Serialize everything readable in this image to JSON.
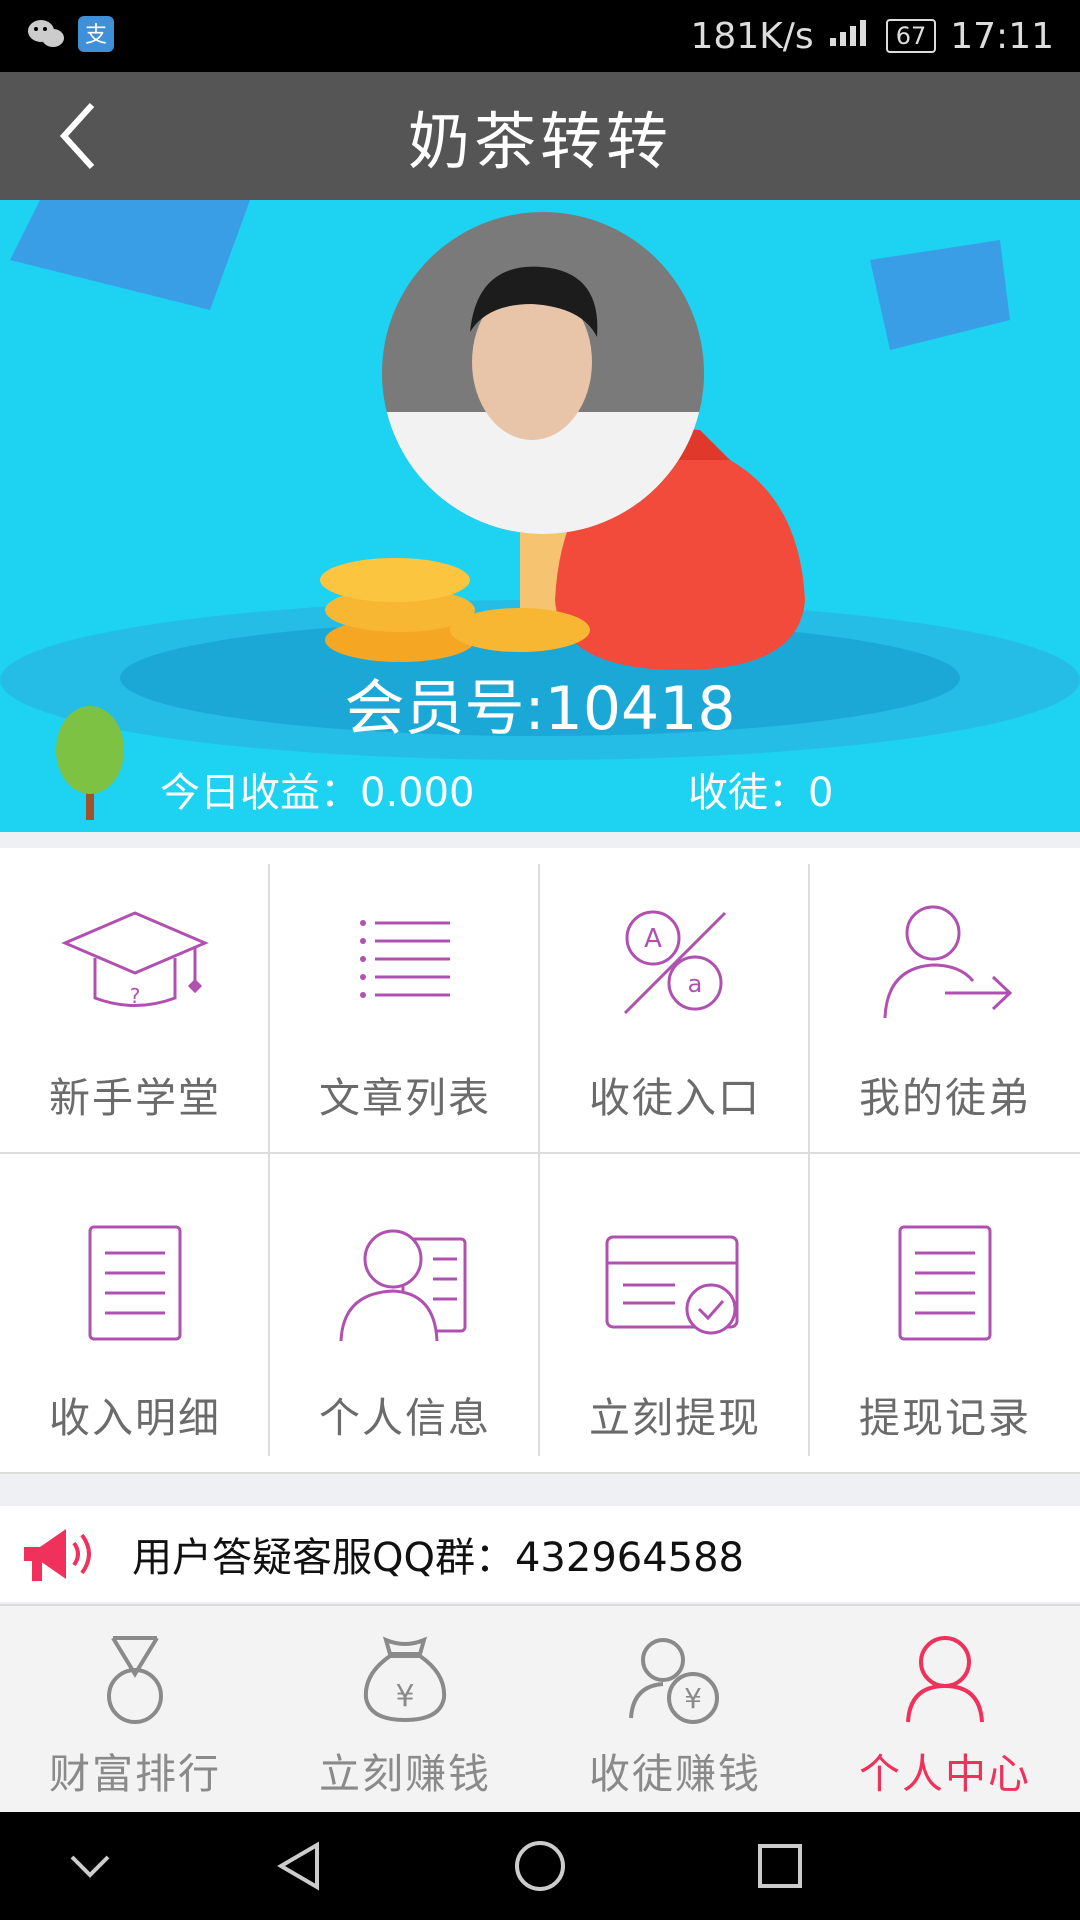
{
  "status_bar": {
    "network_speed": "181K/s",
    "battery": "67",
    "time": "17:11"
  },
  "header": {
    "title": "奶茶转转"
  },
  "banner": {
    "member_id": "会员号:10418",
    "today_income": "今日收益：0.000",
    "apprentices": "收徒：0"
  },
  "menu": {
    "items": [
      {
        "label": "新手学堂",
        "icon": "graduation-cap-icon"
      },
      {
        "label": "文章列表",
        "icon": "list-icon"
      },
      {
        "label": "收徒入口",
        "icon": "translate-icon"
      },
      {
        "label": "我的徒弟",
        "icon": "user-arrow-icon"
      },
      {
        "label": "收入明细",
        "icon": "document-icon"
      },
      {
        "label": "个人信息",
        "icon": "contact-card-icon"
      },
      {
        "label": "立刻提现",
        "icon": "card-check-icon"
      },
      {
        "label": "提现记录",
        "icon": "record-icon"
      }
    ]
  },
  "notice": {
    "text": "用户答疑客服QQ群：432964588"
  },
  "tabbar": {
    "tabs": [
      {
        "label": "财富排行",
        "icon": "medal-icon"
      },
      {
        "label": "立刻赚钱",
        "icon": "money-bag-icon"
      },
      {
        "label": "收徒赚钱",
        "icon": "user-yen-icon"
      },
      {
        "label": "个人中心",
        "icon": "person-icon"
      }
    ],
    "active_index": 3,
    "active_color": "#f0315b"
  },
  "colors": {
    "banner_bg": "#1ed2f1",
    "title_bar_bg": "#555555",
    "icon_color": "#b050b0"
  }
}
